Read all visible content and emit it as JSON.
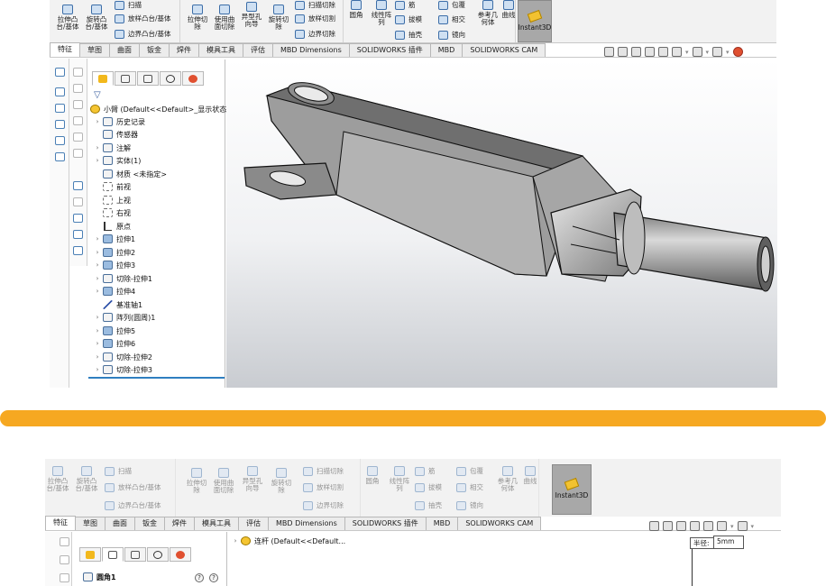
{
  "ribbon": {
    "extrude_boss": "拉伸凸\n台/基体",
    "revolve_boss": "旋转凸\n台/基体",
    "sweep": "扫描",
    "loft": "放样凸台/基体",
    "boundary_boss": "边界凸台/基体",
    "extrude_cut": "拉伸切\n除",
    "surface_cut": "使用曲\n面切除",
    "hole_wizard": "异型孔\n向导",
    "revolve_cut": "旋转切\n除",
    "swept_cut": "扫描切除",
    "lofted_cut": "放样切割",
    "boundary_cut": "边界切除",
    "fillet": "圆角",
    "linear_pattern": "线性阵\n列",
    "rib": "筋",
    "draft": "拔模",
    "shell": "抽壳",
    "wrap": "包覆",
    "intersect": "相交",
    "mirror": "镜向",
    "reference_geometry": "参考几\n何体",
    "curves": "曲线",
    "instant3d": "Instant3D"
  },
  "tabs": [
    "特征",
    "草图",
    "曲面",
    "钣金",
    "焊件",
    "模具工具",
    "评估",
    "MBD Dimensions",
    "SOLIDWORKS 插件",
    "MBD",
    "SOLIDWORKS CAM"
  ],
  "tree": {
    "root": "小臂  (Default<<Default>_显示状态",
    "items": [
      "历史记录",
      "传感器",
      "注解",
      "实体(1)",
      "材质 <未指定>",
      "前视",
      "上视",
      "右视",
      "原点",
      "拉伸1",
      "拉伸2",
      "拉伸3",
      "切除-拉伸1",
      "拉伸4",
      "基准轴1",
      "阵列(圆周)1",
      "拉伸5",
      "拉伸6",
      "切除-拉伸2",
      "切除-拉伸3"
    ]
  },
  "bottom": {
    "root_item": "连杆  (Default<<Default...",
    "fillet_panel": "圆角1",
    "radius_label": "半径:",
    "radius_value": "5mm",
    "help": "?"
  },
  "colors": {
    "divider": "#f6a821",
    "model": "#9a9a9a"
  }
}
